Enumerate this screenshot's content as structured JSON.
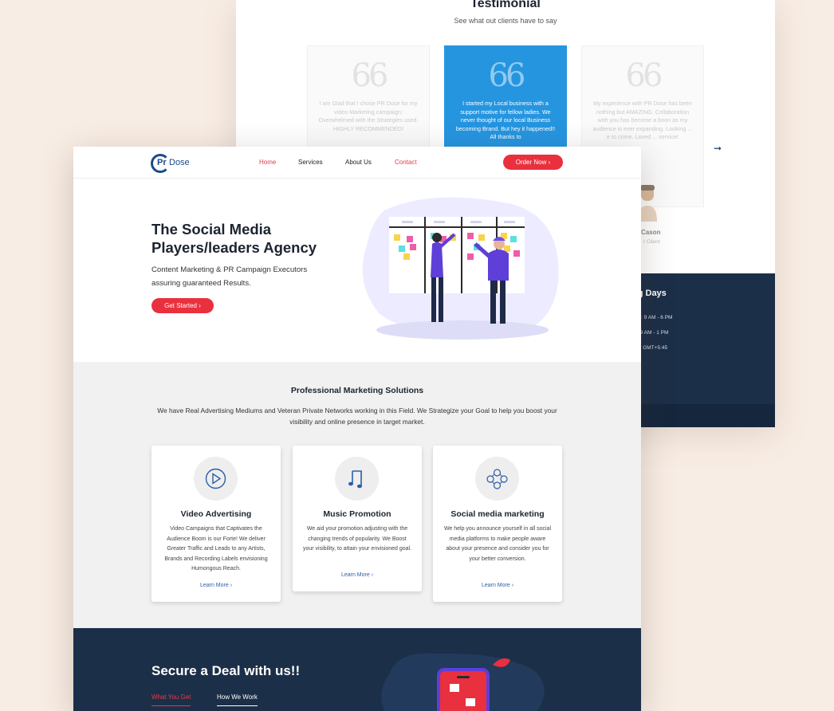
{
  "testimonial": {
    "title": "Testimonial",
    "subtitle": "See what out clients have to say",
    "quote_mark": "66",
    "cards": [
      {
        "text": "I am Glad that I chose PR Dose for my video Marketing campaign; Overwhelmed with the Strategies used. HIGHLY RECOMMENDED!"
      },
      {
        "text": "I started my Local business with a support motive for fellow ladies. We never thought of our local Business becoming Brand. But hey it happened!! All thanks to"
      },
      {
        "text": "My experience with PR Dose has been nothing but AMAZING. Collaboration with you has become a boon as my audience is ever expanding. Looking ... e to come. Loved ... service!"
      }
    ],
    "client_name": "Cason",
    "client_role": "r Client",
    "arrow": "➞"
  },
  "working_days": {
    "title": "ng Days",
    "lines": [
      "s : 9 AM - 6 PM",
      ": 9 AM - 1 PM",
      "e: GMT+5:45"
    ]
  },
  "nav": {
    "logo_pr": "Pr",
    "logo_dose": "Dose",
    "items": [
      "Home",
      "Services",
      "About Us",
      "Contact"
    ],
    "order_button": "Order Now ›"
  },
  "hero": {
    "title": "The Social Media Players/leaders Agency",
    "description": "Content Marketing & PR Campaign Executors assuring guaranteed Results.",
    "cta": "Get Started ›"
  },
  "solutions": {
    "title": "Professional Marketing Solutions",
    "description": "We have Real Advertising Mediums and Veteran Private Networks working in this Field. We Strategize your Goal to help you boost your visibility and online presence in target market.",
    "cards": [
      {
        "icon": "play-circle-icon",
        "title": "Video Advertising",
        "text": "Video Campaigns that Captivates the Audience Boom is our Forte! We deliver Greater Traffic and Leads to any Artists, Brands and Recording Labels envisioning Humongous Reach.",
        "more": "Learn More ›"
      },
      {
        "icon": "music-note-icon",
        "title": "Music Promotion",
        "text": "We aid your promotion adjusting with the changing trends of popularity. We Boost your visibility, to attain your envisioned goal.",
        "more": "Learn More ›"
      },
      {
        "icon": "social-network-icon",
        "title": "Social media marketing",
        "text": "We help you announce yourself in all social media platforms to make people aware about your presence and consider you for your better conversion.",
        "more": "Learn More ›"
      }
    ]
  },
  "deal": {
    "title": "Secure a Deal with us!!",
    "tabs": [
      "What You Get",
      "How We Work"
    ]
  },
  "colors": {
    "accent_red": "#e9303e",
    "testimonial_blue": "#2595e0",
    "navy": "#1c2f48",
    "link_blue": "#2a5ea8",
    "background": "#f8ede4"
  }
}
